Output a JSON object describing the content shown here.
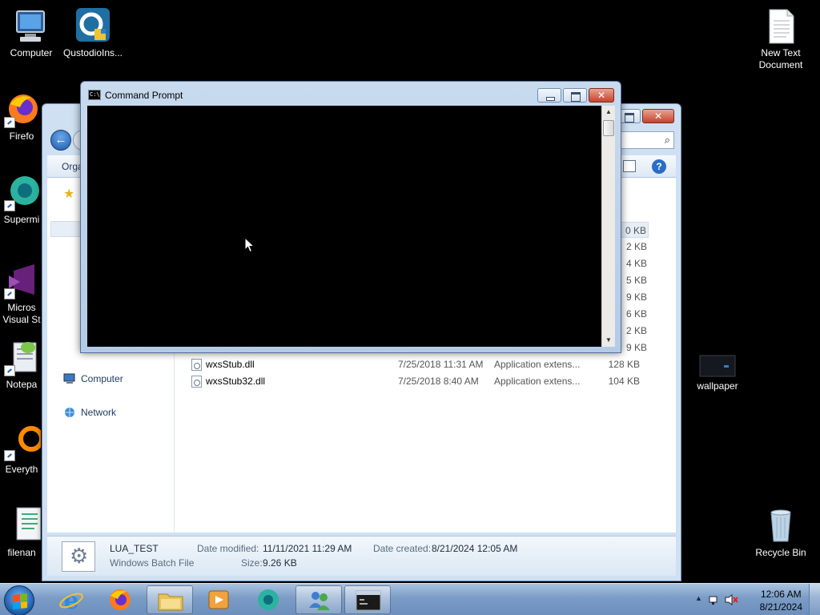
{
  "desktop": {
    "icons_left": [
      {
        "label": "Computer"
      },
      {
        "label": "QustodioIns..."
      },
      {
        "label": "Firefo"
      },
      {
        "label": "Supermi"
      },
      {
        "label": "Micros"
      },
      {
        "label": "Visual St"
      },
      {
        "label": "Notepa"
      },
      {
        "label": "Everyth"
      },
      {
        "label": "filenan"
      }
    ],
    "icons_right": [
      {
        "label": "New Text"
      },
      {
        "label": "Document"
      },
      {
        "label": "wallpaper"
      },
      {
        "label": "Recycle Bin"
      }
    ]
  },
  "explorer": {
    "toolbar": {
      "organize": "Orga"
    },
    "nav": {
      "computer": "Computer",
      "network": "Network"
    },
    "size_peeks": [
      "0 KB",
      "2 KB",
      "4 KB",
      "5 KB",
      "9 KB",
      "6 KB",
      "2 KB",
      "9 KB"
    ],
    "files": [
      {
        "name": "wxsStub.dll",
        "date": "7/25/2018 11:31 AM",
        "type": "Application extens...",
        "size": "128 KB"
      },
      {
        "name": "wxsStub32.dll",
        "date": "7/25/2018 8:40 AM",
        "type": "Application extens...",
        "size": "104 KB"
      }
    ],
    "details": {
      "name": "LUA_TEST",
      "kind": "Windows Batch File",
      "modified_label": "Date modified:",
      "modified_value": "11/11/2021 11:29 AM",
      "size_label": "Size:",
      "size_value": "9.26 KB",
      "created_label": "Date created:",
      "created_value": "8/21/2024 12:05 AM"
    }
  },
  "cmd": {
    "title": "Command Prompt",
    "icon_text": "C:\\_"
  },
  "taskbar": {
    "clock_time": "12:06 AM",
    "clock_date": "8/21/2024"
  },
  "colors": {
    "desktop": "#000000",
    "taskbar": "#7a9cc6",
    "close_button": "#c7432b"
  }
}
